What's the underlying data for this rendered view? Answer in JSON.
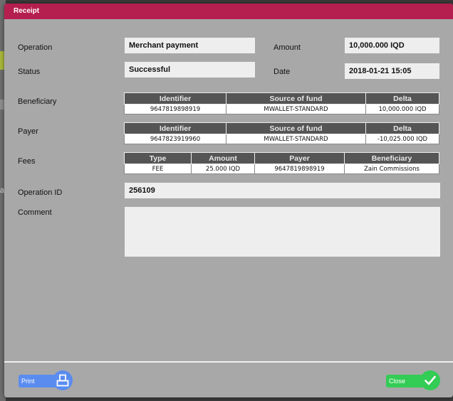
{
  "window": {
    "title": "Receipt"
  },
  "background": {
    "fragment_text": "a"
  },
  "details": {
    "operation_label": "Operation",
    "operation_value": "Merchant payment",
    "amount_label": "Amount",
    "amount_value": "10,000.000 IQD",
    "status_label": "Status",
    "status_value": "Successful",
    "date_label": "Date",
    "date_value": "2018-01-21 15:05",
    "beneficiary_label": "Beneficiary",
    "payer_label": "Payer",
    "fees_label": "Fees",
    "operation_id_label": "Operation ID",
    "operation_id_value": "256109",
    "comment_label": "Comment",
    "comment_value": ""
  },
  "beneficiary_table": {
    "headers": [
      "Identifier",
      "Source of fund",
      "Delta"
    ],
    "rows": [
      [
        "9647819898919",
        "MWALLET-STANDARD",
        "10,000.000 IQD"
      ]
    ]
  },
  "payer_table": {
    "headers": [
      "Identifier",
      "Source of fund",
      "Delta"
    ],
    "rows": [
      [
        "9647823919960",
        "MWALLET-STANDARD",
        "-10,025.000 IQD"
      ]
    ]
  },
  "fees_table": {
    "headers": [
      "Type",
      "Amount",
      "Payer",
      "Beneficiary"
    ],
    "rows": [
      [
        "FEE",
        "25.000 IQD",
        "9647819898919",
        "Zain Commissions"
      ]
    ]
  },
  "footer": {
    "print_label": "Print",
    "close_label": "Close",
    "print_icon": "printer-icon",
    "close_icon": "checkmark-icon"
  },
  "colors": {
    "titlebar": "#b51f4f",
    "print_button": "#5a8cf0",
    "close_button": "#33cc55",
    "table_header": "#555555"
  }
}
